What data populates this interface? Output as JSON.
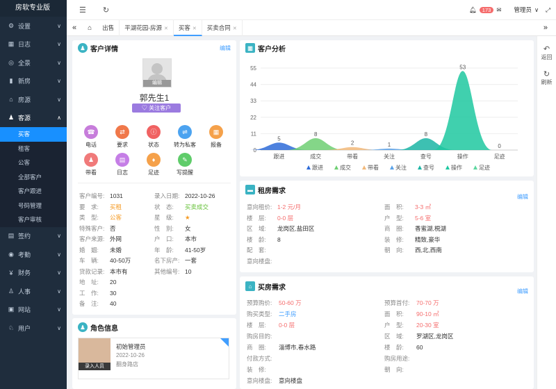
{
  "app": {
    "title": "房软专业版"
  },
  "sidebar": {
    "items": [
      {
        "label": "设置",
        "icon": "gear-icon",
        "g": "⚙",
        "ar": "v"
      },
      {
        "label": "日志",
        "icon": "calendar-icon",
        "g": "▦",
        "ar": "v"
      },
      {
        "label": "全景",
        "icon": "panorama-icon",
        "g": "◎",
        "ar": "v"
      },
      {
        "label": "新房",
        "icon": "building-icon",
        "g": "▮",
        "ar": "v"
      },
      {
        "label": "房源",
        "icon": "house-icon",
        "g": "⌂",
        "ar": "v"
      },
      {
        "label": "客源",
        "icon": "users-icon",
        "g": "♟",
        "ar": "^"
      }
    ],
    "subitems": [
      "买客",
      "租客",
      "公客",
      "全部客户",
      "客户跟进",
      "号码管理",
      "客户审核"
    ],
    "items2": [
      {
        "label": "签约",
        "icon": "contract-icon",
        "g": "▤",
        "ar": "v"
      },
      {
        "label": "考勤",
        "icon": "location-icon",
        "g": "◉",
        "ar": "v"
      },
      {
        "label": "财务",
        "icon": "finance-icon",
        "g": "¥",
        "ar": "v"
      },
      {
        "label": "人事",
        "icon": "person-icon",
        "g": "♙",
        "ar": "v"
      },
      {
        "label": "网站",
        "icon": "website-icon",
        "g": "▣",
        "ar": "v"
      },
      {
        "label": "用户",
        "icon": "user-icon",
        "g": "♘",
        "ar": "v"
      }
    ]
  },
  "header": {
    "notif_count": "173",
    "user": "管理员"
  },
  "tabs": [
    "出售",
    "平湖花园-房源",
    "买客",
    "买卖合同"
  ],
  "customer": {
    "title": "客户详情",
    "edit": "编辑",
    "avatar_edit": "编辑",
    "name": "郭先生1",
    "follow": "关注客户",
    "actions": [
      {
        "label": "电话",
        "color": "#c77ddb",
        "g": "☎"
      },
      {
        "label": "要求",
        "color": "#f0784a",
        "g": "⇄"
      },
      {
        "label": "状态",
        "color": "#f06262",
        "g": "ⓘ"
      },
      {
        "label": "转为私客",
        "color": "#4ca3f0",
        "g": "⇌"
      },
      {
        "label": "报备",
        "color": "#f5a14a",
        "g": "▦"
      },
      {
        "label": "带看",
        "color": "#f07a7a",
        "g": "♟"
      },
      {
        "label": "日志",
        "color": "#c57ee6",
        "g": "▤"
      },
      {
        "label": "足迹",
        "color": "#f5a14a",
        "g": "♦"
      },
      {
        "label": "写提醒",
        "color": "#5fcc6a",
        "g": "✎"
      }
    ],
    "left": [
      {
        "k": "客户编号:",
        "v": "1031"
      },
      {
        "k": "要　求:",
        "v": "买租",
        "c": "or"
      },
      {
        "k": "类　型:",
        "v": "公客",
        "c": "or"
      },
      {
        "k": "特殊客户:",
        "v": "否"
      },
      {
        "k": "客户来源:",
        "v": "外网"
      },
      {
        "k": "婚　姻:",
        "v": "未婚"
      },
      {
        "k": "车　辆:",
        "v": "40-50万"
      },
      {
        "k": "贷款记录:",
        "v": "本市有"
      },
      {
        "k": "地　址:",
        "v": "20"
      },
      {
        "k": "工　作:",
        "v": "30"
      },
      {
        "k": "备　注:",
        "v": "40"
      }
    ],
    "right": [
      {
        "k": "录入日期:",
        "v": "2022-10-26"
      },
      {
        "k": "状　态:",
        "v": "买卖成交",
        "c": "gr"
      },
      {
        "k": "星　级:",
        "v": "★",
        "c": "or"
      },
      {
        "k": "性　别:",
        "v": "女"
      },
      {
        "k": "户　口:",
        "v": "本市"
      },
      {
        "k": "年　龄:",
        "v": "41-50岁"
      },
      {
        "k": "名下房产:",
        "v": "一套"
      },
      {
        "k": "其他编号:",
        "v": "10"
      }
    ]
  },
  "role": {
    "title": "角色信息",
    "name": "初始管理员",
    "date": "2022-10-26",
    "store": "翻身路店",
    "tag": "录入人员"
  },
  "analysis": {
    "title": "客户分析"
  },
  "chart_data": {
    "type": "area",
    "categories": [
      "跟进",
      "成交",
      "带看",
      "关注",
      "查号",
      "操作",
      "足迹"
    ],
    "values": [
      5,
      8,
      2,
      1,
      8,
      53,
      0
    ],
    "ylim": [
      0,
      55
    ],
    "yticks": [
      0,
      11,
      22,
      33,
      44,
      55
    ],
    "colors": [
      "#2e6bd8",
      "#6fcf73",
      "#f2b97a",
      "#5aa2e8",
      "#1bb5a5",
      "#1ec8a0",
      "#5ed7a0"
    ]
  },
  "rent": {
    "title": "租房需求",
    "edit": "编辑",
    "left": [
      {
        "k": "意向租价:",
        "v": "1-2 元/月",
        "c": "rd"
      },
      {
        "k": "楼　层:",
        "v": "0-0 层",
        "c": "rd"
      },
      {
        "k": "区　域:",
        "v": "龙岗区,盐田区"
      },
      {
        "k": "楼　龄:",
        "v": "8"
      },
      {
        "k": "配　套:",
        "v": ""
      },
      {
        "k": "意向楼盘:",
        "v": ""
      }
    ],
    "right": [
      {
        "k": "面　积:",
        "v": "3-3 ㎡",
        "c": "rd"
      },
      {
        "k": "户　型:",
        "v": "5-6 室",
        "c": "rd"
      },
      {
        "k": "商　圈:",
        "v": "香蜜湖,梘湖"
      },
      {
        "k": "装　修:",
        "v": "精致,豪华"
      },
      {
        "k": "朝　向:",
        "v": "西,北,西南"
      }
    ]
  },
  "buy": {
    "title": "买房需求",
    "edit": "编辑",
    "left": [
      {
        "k": "预算购价:",
        "v": "50-60 万",
        "c": "rd"
      },
      {
        "k": "购买类型:",
        "v": "二手房",
        "c": "bl"
      },
      {
        "k": "楼　层:",
        "v": "0-0 层",
        "c": "rd"
      },
      {
        "k": "购房目的:",
        "v": ""
      },
      {
        "k": "商　圈:",
        "v": "淄博市,春水路"
      },
      {
        "k": "付款方式:",
        "v": ""
      },
      {
        "k": "装　修:",
        "v": ""
      },
      {
        "k": "意向楼盘:",
        "v": "意向楼盘"
      }
    ],
    "right": [
      {
        "k": "预算首付:",
        "v": "70-70 万",
        "c": "rd"
      },
      {
        "k": "面　积:",
        "v": "90-10 ㎡",
        "c": "rd"
      },
      {
        "k": "户　型:",
        "v": "20-30 室",
        "c": "rd"
      },
      {
        "k": "区　域:",
        "v": "罗湖区,龙岗区"
      },
      {
        "k": "楼　龄:",
        "v": "60"
      },
      {
        "k": "购房用途:",
        "v": ""
      },
      {
        "k": "朝　向:",
        "v": ""
      }
    ]
  },
  "side_tools": {
    "back": "返回",
    "refresh": "刷新"
  }
}
